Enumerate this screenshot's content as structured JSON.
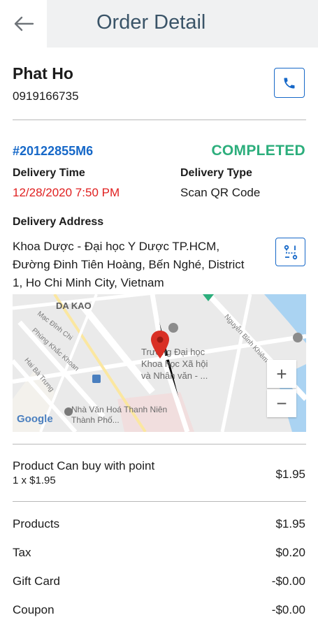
{
  "header": {
    "title": "Order Detail"
  },
  "customer": {
    "name": "Phat Ho",
    "phone": "0919166735"
  },
  "order": {
    "id": "#20122855M6",
    "status": "COMPLETED",
    "delivery_time_label": "Delivery Time",
    "delivery_time": "12/28/2020 7:50 PM",
    "delivery_type_label": "Delivery Type",
    "delivery_type": "Scan QR Code",
    "address_label": "Delivery Address",
    "address": "Khoa Dược - Đại học Y Dược TP.HCM, Đường Đinh Tiên Hoàng, Bến Nghé, District 1, Ho Chi Minh City, Vietnam"
  },
  "map": {
    "area_label": "DA KAO",
    "street_1": "Mạc Đĩnh Chi",
    "street_2": "Phùng Khắc Khoan",
    "street_3": "Hai Bà Trưng",
    "street_4": "Nguyễn Bỉnh Khiêm",
    "poi_1": "Trường Đại học Khoa học Xã hội và Nhân văn - ...",
    "poi_2": "Nhà Văn Hoá Thanh Niên Thành Phố...",
    "logo": "Google",
    "zoom_in": "+",
    "zoom_out": "−"
  },
  "product": {
    "name": "Product Can buy with point",
    "qty_price": "1 x $1.95",
    "total": "$1.95"
  },
  "summary": [
    {
      "label": "Products",
      "value": "$1.95"
    },
    {
      "label": "Tax",
      "value": "$0.20"
    },
    {
      "label": "Gift Card",
      "value": "-$0.00"
    },
    {
      "label": "Coupon",
      "value": "-$0.00"
    }
  ],
  "colors": {
    "accent": "#1668c8",
    "status": "#2cae7c",
    "time": "#e02020",
    "title": "#3a5468"
  }
}
